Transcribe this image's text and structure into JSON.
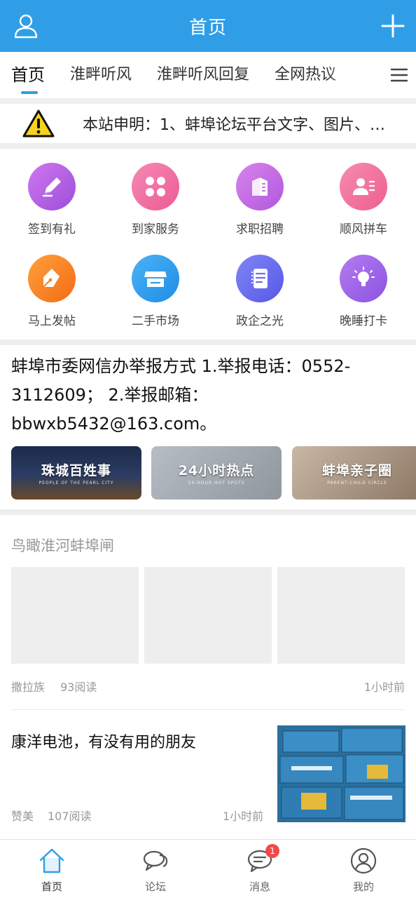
{
  "header": {
    "title": "首页"
  },
  "tabs": [
    {
      "label": "首页"
    },
    {
      "label": "淮畔听风"
    },
    {
      "label": "淮畔听风回复"
    },
    {
      "label": "全网热议"
    }
  ],
  "notice": {
    "text": "本站申明：1、蚌埠论坛平台文字、图片、…"
  },
  "grid": {
    "items": [
      {
        "label": "签到有礼",
        "icon": "pencil-icon",
        "color": "#b05de0"
      },
      {
        "label": "到家服务",
        "icon": "four-leaf-icon",
        "color": "#f06aa2"
      },
      {
        "label": "求职招聘",
        "icon": "building-icon",
        "color": "#c46be3"
      },
      {
        "label": "顺风拼车",
        "icon": "person-list-icon",
        "color": "#f3709c"
      },
      {
        "label": "马上发帖",
        "icon": "fountain-pen-icon",
        "color": "#f6862a"
      },
      {
        "label": "二手市场",
        "icon": "shop-icon",
        "color": "#2e9df0"
      },
      {
        "label": "政企之光",
        "icon": "document-icon",
        "color": "#6b6ef0"
      },
      {
        "label": "晚睡打卡",
        "icon": "lightbulb-icon",
        "color": "#a05fe8"
      }
    ]
  },
  "announcement": {
    "text": "蚌埠市委网信办举报方式 1.举报电话：0552-3112609； 2.举报邮箱：bbwxb5432@163.com。"
  },
  "banners": [
    {
      "title": "珠城百姓事",
      "subtitle": "PEOPLE OF THE PEARL CITY"
    },
    {
      "title": "24小时热点",
      "subtitle": "24-HOUR HOT SPOTS"
    },
    {
      "title": "蚌埠亲子圈",
      "subtitle": "PARENT-CHILD CIRCLE"
    }
  ],
  "posts": [
    {
      "title": "鸟瞰淮河蚌埠闸",
      "author": "撒拉族",
      "reads": "93阅读",
      "time": "1小时前"
    },
    {
      "title": "康洋电池，有没有用的朋友",
      "author": "赞美",
      "reads": "107阅读",
      "time": "1小时前"
    }
  ],
  "bottom_nav": [
    {
      "label": "首页",
      "icon": "home-icon"
    },
    {
      "label": "论坛",
      "icon": "chat-bubbles-icon"
    },
    {
      "label": "消息",
      "icon": "message-icon",
      "badge": "1"
    },
    {
      "label": "我的",
      "icon": "profile-icon"
    }
  ],
  "colors": {
    "brand": "#2f9ee6",
    "badge": "#f04a4a"
  }
}
